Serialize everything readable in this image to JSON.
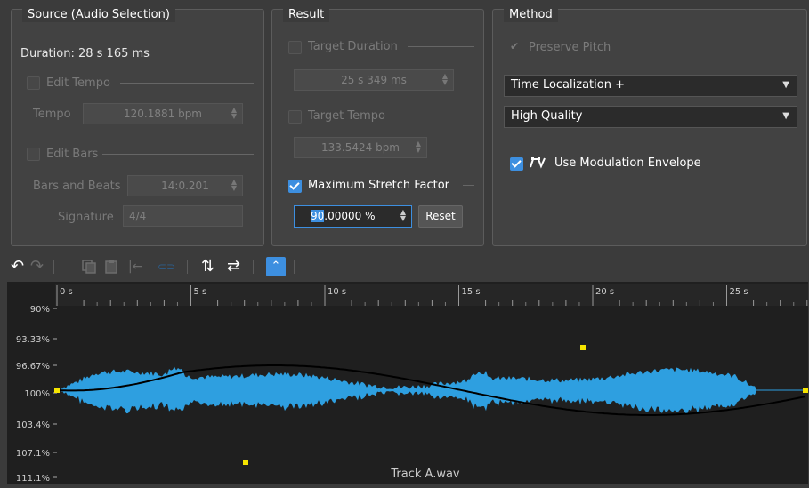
{
  "source": {
    "title": "Source (Audio Selection)",
    "duration": "Duration: 28 s 165 ms",
    "edit_tempo_label": "Edit Tempo",
    "tempo_label": "Tempo",
    "tempo_value": "120.1881 bpm",
    "edit_bars_label": "Edit Bars",
    "bars_beats_label": "Bars and Beats",
    "bars_beats_value": "14:0.201",
    "signature_label": "Signature",
    "signature_value": "4/4"
  },
  "result": {
    "title": "Result",
    "target_duration_label": "Target Duration",
    "target_duration_value": "25 s 349 ms",
    "target_tempo_label": "Target Tempo",
    "target_tempo_value": "133.5424 bpm",
    "max_stretch_label": "Maximum Stretch Factor",
    "max_stretch_value_selected": "90",
    "max_stretch_value_rest": ".00000 %",
    "reset_label": "Reset"
  },
  "method": {
    "title": "Method",
    "preserve_pitch_label": "Preserve Pitch",
    "algorithm_value": "Time Localization +",
    "quality_value": "High Quality",
    "use_mod_env_label": "Use Modulation Envelope"
  },
  "toolbar": {
    "icons": [
      "undo-icon",
      "redo-icon",
      "copy-icon",
      "paste-icon",
      "align-left-icon",
      "link-icon",
      "swap-vertical-icon",
      "swap-horizontal-icon",
      "envelope-mode-icon"
    ]
  },
  "waveform": {
    "ruler_labels": [
      "0 s",
      "5 s",
      "10 s",
      "15 s",
      "20 s",
      "25 s"
    ],
    "y_labels": [
      "90%",
      "93.33%",
      "96.67%",
      "100%",
      "103.4%",
      "107.1%",
      "111.1%"
    ],
    "track_name": "Track A.wav",
    "wave_color": "#2e9fe0",
    "envelope_color": "#000000",
    "handle_color": "#f5e400"
  }
}
